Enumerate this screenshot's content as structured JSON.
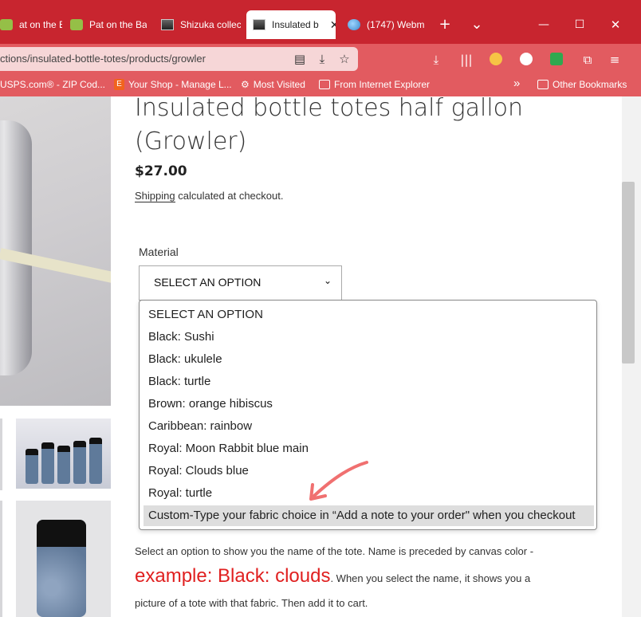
{
  "browser": {
    "tabs": [
      {
        "label": "at on the Ba",
        "icon": "shopify-icon",
        "active": false
      },
      {
        "label": "Pat on the Bac",
        "icon": "shopify-icon",
        "active": false
      },
      {
        "label": "Shizuka collec",
        "icon": "photo-icon",
        "active": false
      },
      {
        "label": "Insulated b",
        "icon": "photo-icon",
        "active": true
      },
      {
        "label": "(1747) Webm",
        "icon": "globe-icon",
        "active": false
      }
    ],
    "new_tab": "+",
    "tab_list": "⌄",
    "minimize": "—",
    "maximize": "☐",
    "close": "✕",
    "url": "ctions/insulated-bottle-totes/products/growler",
    "bookmarks": [
      {
        "label": "USPS.com® - ZIP Cod...",
        "icon": "none"
      },
      {
        "label": "Your Shop - Manage L...",
        "icon": "etsy-icon"
      },
      {
        "label": "Most Visited",
        "icon": "gear-icon"
      },
      {
        "label": "From Internet Explorer",
        "icon": "folder-icon"
      }
    ],
    "bookmarks_more": "»",
    "other_bookmarks": "Other Bookmarks"
  },
  "product": {
    "title": "Insulated bottle totes half gallon (Growler)",
    "price": "$27.00",
    "shipping_link": "Shipping",
    "shipping_rest": " calculated at checkout.",
    "material_label": "Material",
    "select_value": "SELECT AN OPTION",
    "options": [
      "SELECT AN OPTION",
      "Black: Sushi",
      "Black: ukulele",
      "Black: turtle",
      "Brown: orange hibiscus",
      "Caribbean: rainbow",
      "Royal: Moon Rabbit blue main",
      "Royal: Clouds blue",
      "Royal: turtle",
      "Custom-Type your fabric choice in “Add a note to your order\" when you checkout"
    ],
    "highlighted_index": 9,
    "help_line1": "Select an option to show you the name of the tote. Name is preceded by canvas color -",
    "help_example": "example: Black: clouds",
    "help_line2": ". When you select the name, it shows you a",
    "help_line3": "picture of a tote with that fabric. Then add it to cart."
  },
  "colors": {
    "tabbar": "#c8252f",
    "toolbar": "#e25b60",
    "accent_red": "#e02020",
    "annotation_arrow": "#f07070"
  }
}
